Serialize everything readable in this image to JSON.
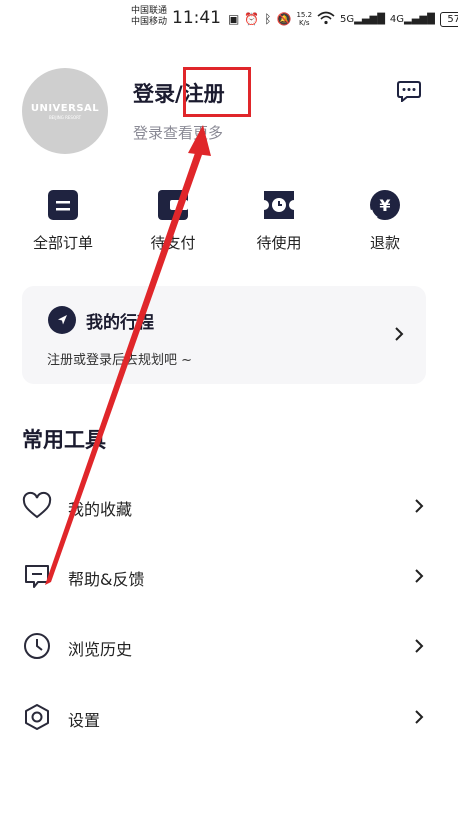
{
  "status_bar": {
    "carrier1": "中国联通",
    "carrier2": "中国移动",
    "time": "11:41",
    "speed_value": "15.2",
    "speed_unit": "K/s",
    "battery": "57"
  },
  "profile": {
    "avatar_text": "UNIVERSAL",
    "avatar_subtext": "BEIJING RESORT",
    "login_title": "登录/注册",
    "login_subtitle": "登录查看更多"
  },
  "orders": [
    {
      "label": "全部订单",
      "icon": "all-orders-icon"
    },
    {
      "label": "待支付",
      "icon": "pending-payment-icon"
    },
    {
      "label": "待使用",
      "icon": "to-use-icon"
    },
    {
      "label": "退款",
      "icon": "refund-icon"
    }
  ],
  "trip": {
    "title": "我的行程",
    "subtitle": "注册或登录后去规划吧 ~"
  },
  "tools": {
    "section_title": "常用工具",
    "items": [
      {
        "label": "我的收藏",
        "icon": "heart-icon"
      },
      {
        "label": "帮助&反馈",
        "icon": "feedback-icon"
      },
      {
        "label": "浏览历史",
        "icon": "clock-icon"
      },
      {
        "label": "设置",
        "icon": "settings-icon"
      }
    ]
  },
  "colors": {
    "primary_dark": "#1f2340",
    "annotation_red": "#e0262a"
  }
}
